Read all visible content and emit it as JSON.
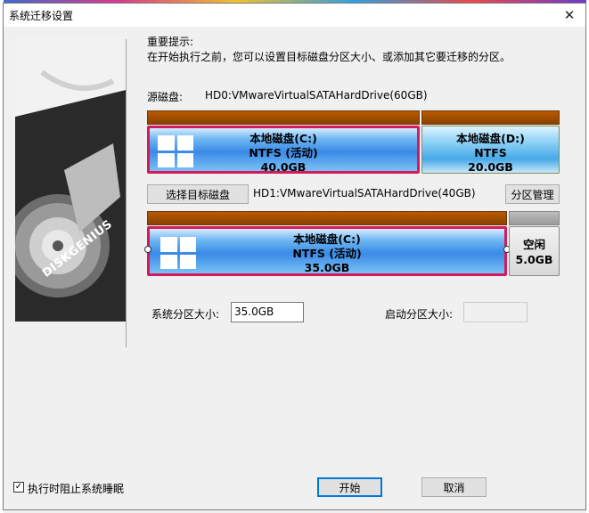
{
  "dialog": {
    "title": "系统迁移设置",
    "close_glyph": "✕"
  },
  "hint": {
    "heading": "重要提示:",
    "body": "在开始执行之前，您可以设置目标磁盘分区大小、或添加其它要迁移的分区。"
  },
  "art": {
    "brand": "DISKGENIUS"
  },
  "source": {
    "label": "源磁盘:",
    "disk_name": "HD0:VMwareVirtualSATAHardDrive(60GB)",
    "partitions": [
      {
        "name": "本地磁盘(C:)",
        "fs": "NTFS (活动)",
        "size": "40.0GB"
      },
      {
        "name": "本地磁盘(D:)",
        "fs": "NTFS",
        "size": "20.0GB"
      }
    ]
  },
  "target": {
    "select_button": "选择目标磁盘",
    "disk_name": "HD1:VMwareVirtualSATAHardDrive(40GB)",
    "manage_button": "分区管理",
    "partitions": [
      {
        "name": "本地磁盘(C:)",
        "fs": "NTFS (活动)",
        "size": "35.0GB"
      },
      {
        "name": "空闲",
        "size": "5.0GB"
      }
    ]
  },
  "fields": {
    "system_size_label": "系统分区大小:",
    "system_size_value": "35.0GB",
    "boot_size_label": "启动分区大小:",
    "boot_size_value": ""
  },
  "footer": {
    "prevent_sleep_label": "执行时阻止系统睡眠",
    "prevent_sleep_checked": true,
    "start_button": "开始",
    "cancel_button": "取消"
  },
  "colors": {
    "selected_border": "#d6195a",
    "disk_bar": "#a05000",
    "partition_blue": "#3a8ae6",
    "default_button_border": "#0078d7"
  }
}
